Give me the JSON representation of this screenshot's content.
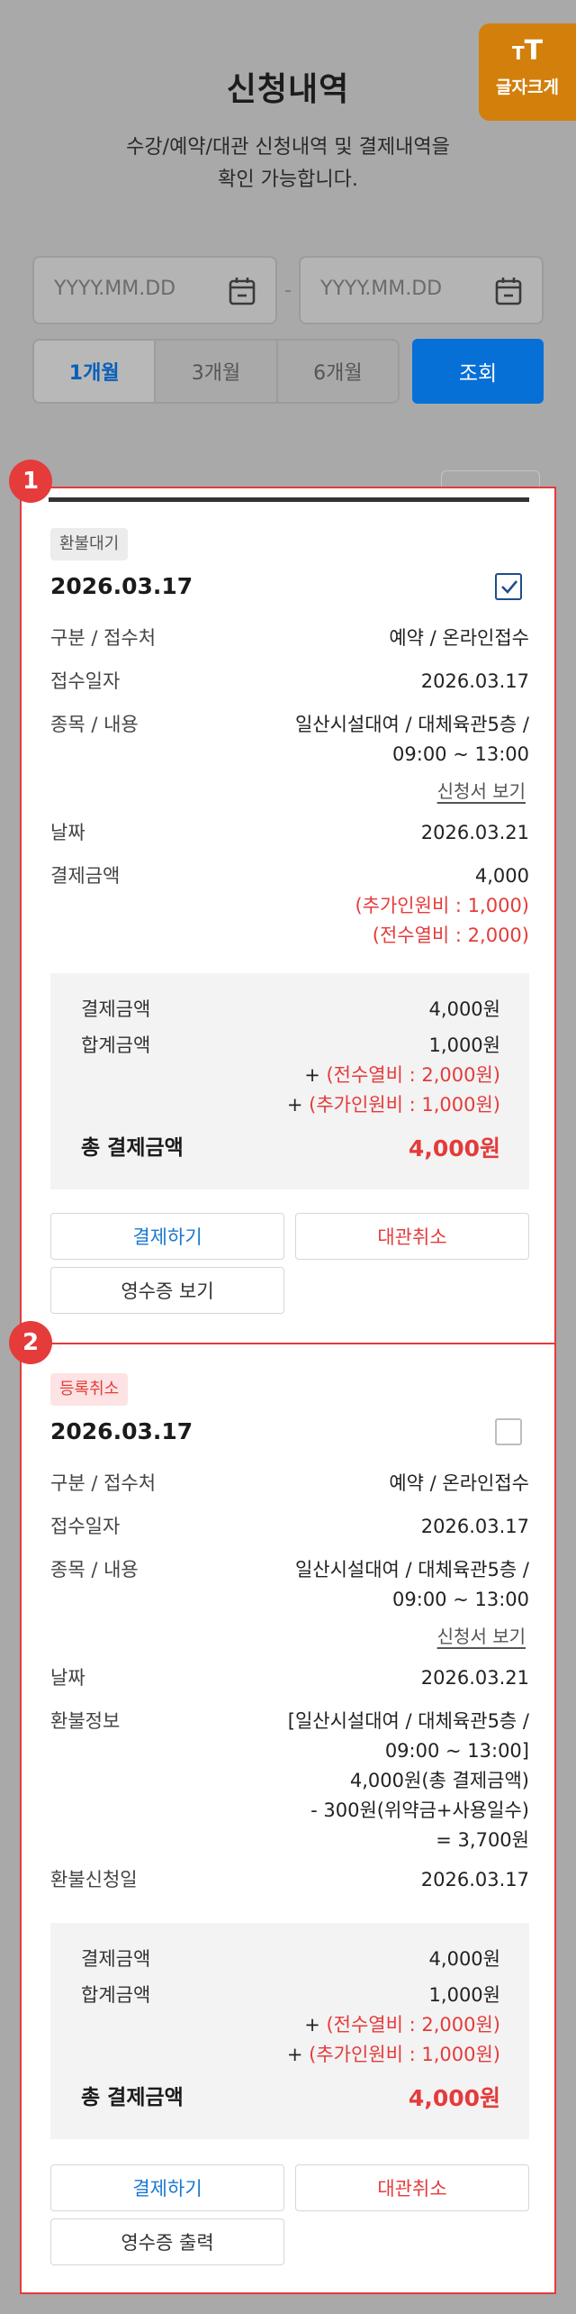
{
  "header": {
    "title": "신청내역",
    "desc_line1": "수강/예약/대관 신청내역 및 결제내역을",
    "desc_line2": "확인 가능합니다.",
    "font_size_button": "글자크게",
    "font_size_glyph_big": "T",
    "font_size_glyph_small": "T"
  },
  "filter": {
    "start_placeholder": "YYYY.MM.DD",
    "end_placeholder": "YYYY.MM.DD",
    "date_separator": "-",
    "periods": [
      "1개월",
      "3개월",
      "6개월"
    ],
    "selected_period": "1개월",
    "search_label": "조회",
    "accent_color": "#0670d6"
  },
  "cards": [
    {
      "badge_number": "1",
      "status": "환불대기",
      "date": "2026.03.17",
      "checked": true,
      "category_label": "구분 / 접수처",
      "category_value": "예약 / 온라인접수",
      "received_label": "접수일자",
      "received_value": "2026.03.17",
      "item_label": "종목 / 내용",
      "item_value_line1": "일산시설대여 / 대체육관5층 /",
      "item_value_line2": "09:00 ~ 13:00",
      "application_link": "신청서 보기",
      "date_label": "날짜",
      "date_value": "2026.03.21",
      "pay_label": "결제금액",
      "pay_value": "4,000",
      "pay_extra1": "(추가인원비 : 1,000)",
      "pay_extra2": "(전수열비 : 2,000)",
      "summary": {
        "pay_label": "결제금액",
        "pay_value": "4,000원",
        "sum_label": "합계금액",
        "sum_value": "1,000원",
        "sum_extra1_prefix": "+ ",
        "sum_extra1": "(전수열비 : 2,000원)",
        "sum_extra2_prefix": "+ ",
        "sum_extra2": "(추가인원비 : 1,000원)",
        "total_label": "총 결제금액",
        "total_value": "4,000원"
      },
      "buttons": {
        "pay": "결제하기",
        "cancel": "대관취소",
        "receipt": "영수증 보기"
      }
    },
    {
      "badge_number": "2",
      "status": "등록취소",
      "date": "2026.03.17",
      "checked": false,
      "category_label": "구분 / 접수처",
      "category_value": "예약 / 온라인접수",
      "received_label": "접수일자",
      "received_value": "2026.03.17",
      "item_label": "종목 / 내용",
      "item_value_line1": "일산시설대여 / 대체육관5층 /",
      "item_value_line2": "09:00 ~ 13:00",
      "application_link": "신청서 보기",
      "date_label": "날짜",
      "date_value": "2026.03.21",
      "refund_label": "환불정보",
      "refund_line1": "[일산시설대여 / 대체육관5층 /",
      "refund_line2": "09:00 ~ 13:00]",
      "refund_line3": "4,000원(총 결제금액)",
      "refund_line4": "- 300원(위약금+사용일수)",
      "refund_line5": "= 3,700원",
      "refund_date_label": "환불신청일",
      "refund_date_value": "2026.03.17",
      "summary": {
        "pay_label": "결제금액",
        "pay_value": "4,000원",
        "sum_label": "합계금액",
        "sum_value": "1,000원",
        "sum_extra1_prefix": "+ ",
        "sum_extra1": "(전수열비 : 2,000원)",
        "sum_extra2_prefix": "+ ",
        "sum_extra2": "(추가인원비 : 1,000원)",
        "total_label": "총 결제금액",
        "total_value": "4,000원"
      },
      "buttons": {
        "pay": "결제하기",
        "cancel": "대관취소",
        "receipt": "영수증 출력"
      }
    }
  ],
  "colors": {
    "highlight_red": "#e53b3b",
    "overlay_gray": "#a9a9a9",
    "font_button_orange": "#d37f0c"
  }
}
